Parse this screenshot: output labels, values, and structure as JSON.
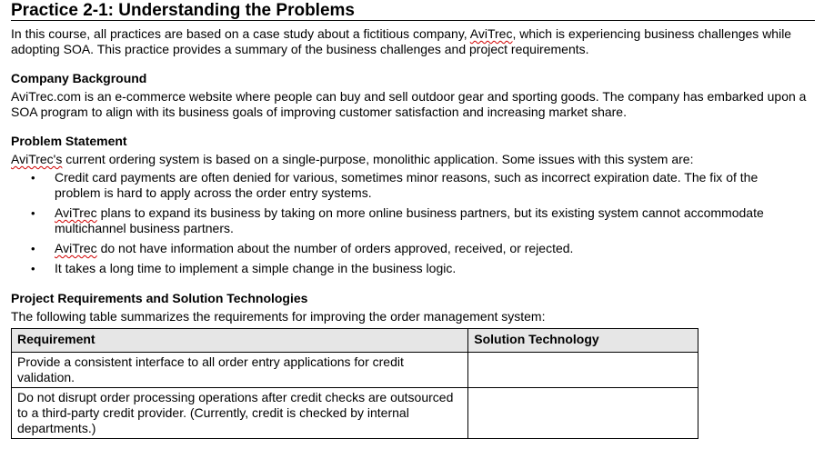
{
  "title": "Practice 2-1: Understanding the Problems",
  "intro": {
    "before": "In this course, all practices are based on a case study about a fictitious company, ",
    "company": "AviTrec",
    "after": ", which is experiencing business challenges while adopting SOA. This practice provides a summary of the business challenges and project requirements."
  },
  "company_background": {
    "heading": "Company Background",
    "text": "AviTrec.com is an e-commerce website where people can buy and sell outdoor gear and sporting goods. The company has embarked upon a SOA program to align with its business goals of improving customer satisfaction and increasing market share."
  },
  "problem_statement": {
    "heading": "Problem Statement",
    "lead_company": "AviTrec's",
    "lead_text": " current ordering system is based on a single-purpose, monolithic application. Some issues with this system are:",
    "bullet_glyph": "•",
    "issues": [
      {
        "pre": "",
        "company": "",
        "text": "Credit card payments are often denied for various, sometimes minor reasons, such as incorrect expiration date. The fix of the problem is hard to apply across the order entry systems."
      },
      {
        "pre": "",
        "company": "AviTrec",
        "text": " plans to expand its business by taking on more online business partners, but its existing system cannot accommodate multichannel business partners."
      },
      {
        "pre": "",
        "company": "AviTrec",
        "text": " do not have information about the number of orders approved, received, or rejected."
      },
      {
        "pre": "",
        "company": "",
        "text": "It takes a long time to implement a simple change in the business logic."
      }
    ]
  },
  "project_requirements": {
    "heading": "Project Requirements and Solution Technologies",
    "text": "The following table summarizes the requirements for improving the order management system:",
    "columns": [
      "Requirement",
      "Solution Technology"
    ],
    "header_bg": "#e6e6e6",
    "rows": [
      {
        "requirement": "Provide a consistent interface to all order entry applications for credit validation.",
        "solution": ""
      },
      {
        "requirement": "Do not disrupt order processing operations after credit checks are outsourced to a third-party credit provider. (Currently, credit is checked by internal departments.)",
        "solution": ""
      }
    ]
  }
}
